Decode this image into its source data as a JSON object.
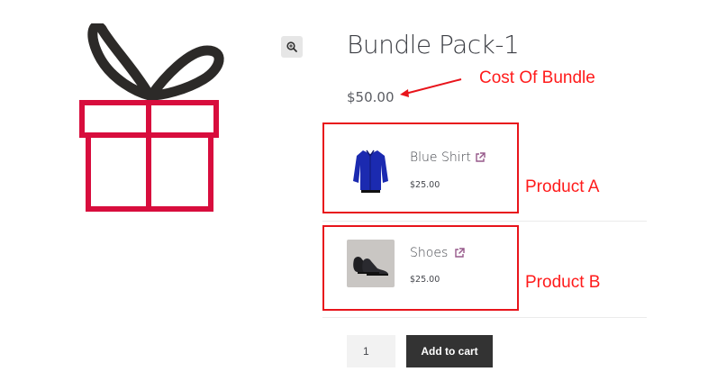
{
  "product": {
    "title": "Bundle Pack-1",
    "price": "$50.00",
    "image_icon": "gift-icon",
    "zoom_icon": "zoom-icon"
  },
  "bundle_items": [
    {
      "name": "Blue Shirt",
      "price": "$25.00",
      "thumb_icon": "shirt-thumbnail",
      "link_icon": "external-link-icon"
    },
    {
      "name": "Shoes",
      "price": "$25.00",
      "thumb_icon": "shoes-thumbnail",
      "link_icon": "external-link-icon"
    }
  ],
  "annotations": {
    "cost": "Cost Of Bundle",
    "product_a": "Product A",
    "product_b": "Product B"
  },
  "cart": {
    "quantity": "1",
    "add_to_cart_label": "Add to cart"
  },
  "colors": {
    "gift_red": "#d80d3d",
    "gift_bow": "#2c2a28",
    "annotation_red": "#e8141b",
    "button_dark": "#333333",
    "link_icon": "#96588a"
  }
}
